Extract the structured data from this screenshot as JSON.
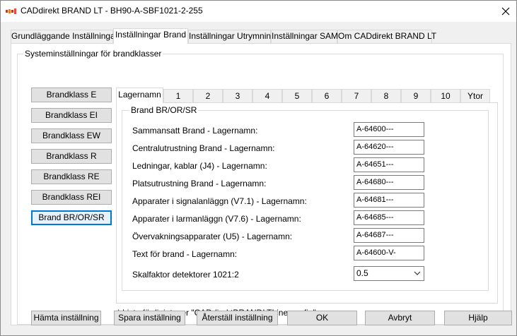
{
  "window": {
    "title": "CADdirekt BRAND LT - BH90-A-SBF1021-2-255"
  },
  "main_tabs": [
    {
      "label": "Grundläggande Inställningar"
    },
    {
      "label": "Inställningar Brand"
    },
    {
      "label": "Inställningar Utrymning"
    },
    {
      "label": "Inställningar SAM"
    },
    {
      "label": "Om CADdirekt BRAND LT"
    }
  ],
  "system_group": {
    "title": "Systeminställningar för brandklasser"
  },
  "class_buttons": [
    {
      "label": "Brandklass E"
    },
    {
      "label": "Brandklass EI"
    },
    {
      "label": "Brandklass EW"
    },
    {
      "label": "Brandklass R"
    },
    {
      "label": "Brandklass RE"
    },
    {
      "label": "Brandklass REI"
    },
    {
      "label": "Brand BR/OR/SR"
    }
  ],
  "inner_tabs": [
    {
      "label": "Lagernamn"
    },
    {
      "label": "1"
    },
    {
      "label": "2"
    },
    {
      "label": "3"
    },
    {
      "label": "4"
    },
    {
      "label": "5"
    },
    {
      "label": "6"
    },
    {
      "label": "7"
    },
    {
      "label": "8"
    },
    {
      "label": "9"
    },
    {
      "label": "10"
    },
    {
      "label": "Ytor"
    }
  ],
  "brand_group": {
    "title": "Brand BR/OR/SR",
    "fields": [
      {
        "label": "Sammansatt Brand - Lagernamn:",
        "value": "A-64600---"
      },
      {
        "label": "Centralutrustning Brand - Lagernamn:",
        "value": "A-64620---"
      },
      {
        "label": "Ledningar, kablar (J4) - Lagernamn:",
        "value": "A-64651---"
      },
      {
        "label": "Platsutrustning Brand - Lagernamn:",
        "value": "A-64680---"
      },
      {
        "label": "Apparater i signalanläggn (V7.1) - Lagernamn:",
        "value": "A-64681---"
      },
      {
        "label": "Apparater i larmanläggn (V7.6) - Lagernamn:",
        "value": "A-64685---"
      },
      {
        "label": "Övervakningsapparater (U5) - Lagernamn:",
        "value": "A-64687---"
      },
      {
        "label": "Text för brand - Lagernamn:",
        "value": "A-64600-V-"
      }
    ],
    "scale": {
      "label": "Skalfaktor detektorer 1021:2",
      "value": "0.5"
    }
  },
  "footnote": "* Lista för linjetyper \"CADdirektBRANDLTLine.config\"",
  "buttons": {
    "fetch": "Hämta inställning",
    "save": "Spara inställning",
    "reset": "Återställ inställning",
    "ok": "OK",
    "cancel": "Avbryt",
    "help": "Hjälp"
  }
}
